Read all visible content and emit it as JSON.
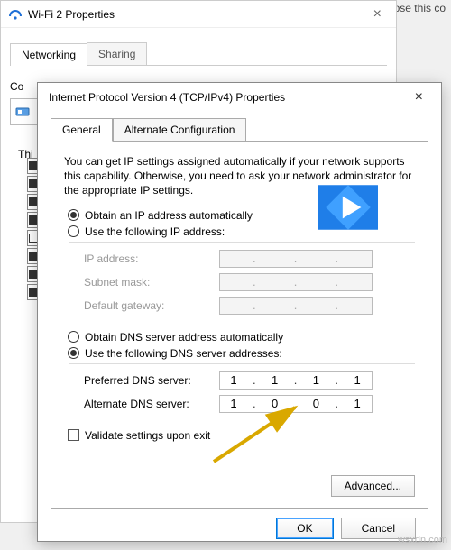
{
  "truncated_text": "gnose this co",
  "bg": {
    "title": "Wi-Fi 2 Properties",
    "tabs": {
      "networking": "Networking",
      "sharing": "Sharing"
    },
    "connect_label": "Connect using:",
    "this_label": "Thi"
  },
  "fg": {
    "title": "Internet Protocol Version 4 (TCP/IPv4) Properties",
    "tabs": {
      "general": "General",
      "alt": "Alternate Configuration"
    },
    "desc": "You can get IP settings assigned automatically if your network supports this capability. Otherwise, you need to ask your network administrator for the appropriate IP settings.",
    "ip": {
      "auto": "Obtain an IP address automatically",
      "manual": "Use the following IP address:",
      "addr_label": "IP address:",
      "mask_label": "Subnet mask:",
      "gw_label": "Default gateway:",
      "selected": "auto"
    },
    "dns": {
      "auto": "Obtain DNS server address automatically",
      "manual": "Use the following DNS server addresses:",
      "pref_label": "Preferred DNS server:",
      "alt_label": "Alternate DNS server:",
      "selected": "manual",
      "preferred": [
        "1",
        "1",
        "1",
        "1"
      ],
      "alternate": [
        "1",
        "0",
        "0",
        "1"
      ]
    },
    "validate": "Validate settings upon exit",
    "advanced": "Advanced...",
    "ok": "OK",
    "cancel": "Cancel"
  },
  "watermark": "wsxdn.com"
}
